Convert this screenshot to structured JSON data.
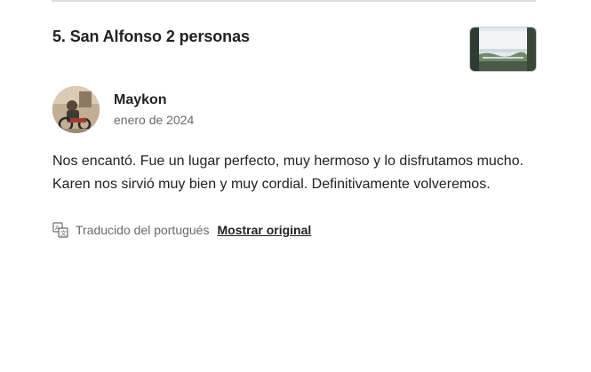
{
  "listing": {
    "title": "5. San Alfonso 2 personas",
    "thumbnail_icon": "apartment-photo-thumbnail"
  },
  "review": {
    "reviewer_name": "Maykon",
    "date": "enero de 2024",
    "avatar_icon": "reviewer-avatar-photo",
    "text": "Nos encantó. Fue un lugar perfecto, muy hermoso y lo disfrutamos mucho. Karen nos sirvió muy bien y muy cordial. Definitivamente volveremos.",
    "translation": {
      "icon": "translate-icon",
      "label": "Traducido del portugués",
      "show_original_link": "Mostrar original"
    }
  },
  "colors": {
    "text_primary": "#222222",
    "text_secondary": "#6a6a6a",
    "divider": "#dddddd"
  }
}
